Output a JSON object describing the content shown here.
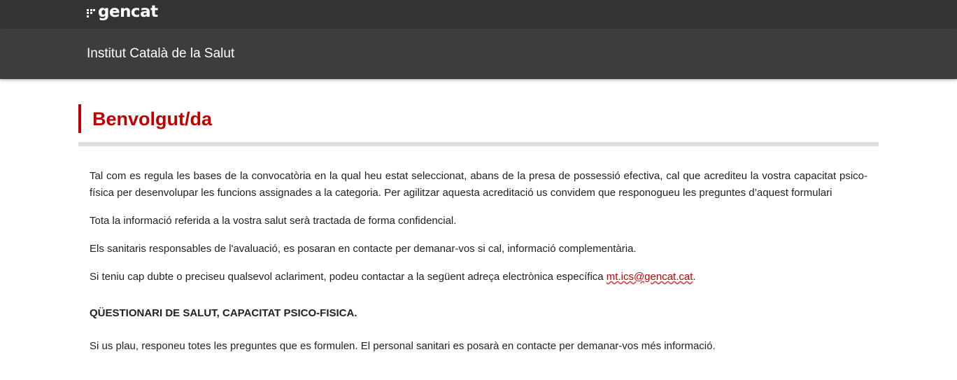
{
  "header": {
    "logo_text": "gencat",
    "subtitle": "Institut Català de la Salut"
  },
  "main": {
    "title": "Benvolgut/da",
    "paragraph1": "Tal com es regula les bases de la convocatòria en la qual heu estat seleccionat, abans de la presa de possessió efectiva, cal que acrediteu la vostra capacitat psico-física per desenvolupar les funcions assignades a la categoria. Per agilitzar aquesta acreditació us convidem que responogueu les preguntes d’aquest formulari",
    "paragraph2": "Tota la informació referida a la vostra salut serà tractada de forma confidencial.",
    "paragraph3": "Els sanitaris responsables de l'avaluació, es posaran en contacte per demanar-vos si cal, informació complementària.",
    "paragraph4_prefix": "Si teniu cap dubte o preciseu qualsevol aclariment, podeu contactar a la següent adreça electrònica específica ",
    "email": "mt.ics@gencat.cat",
    "paragraph4_suffix": ".",
    "section_title": "QÜESTIONARI DE SALUT, CAPACITAT PSICO-FISICA.",
    "paragraph5": "Si us plau, responeu totes les preguntes que es formulen. El personal sanitari es posarà en contacte per demanar-vos més informació."
  },
  "colors": {
    "topbar": "#333333",
    "subbar": "#3d3d3d",
    "accent": "#c00000",
    "rule": "#dedede"
  }
}
